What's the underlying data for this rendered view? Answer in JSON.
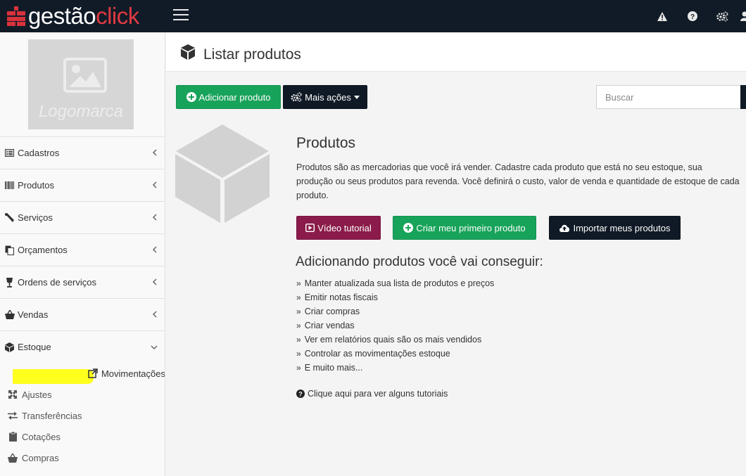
{
  "brand": {
    "part1": "gestão",
    "part2": "click"
  },
  "topbar": {
    "icons": [
      "warning-icon",
      "help-icon",
      "settings-icon",
      "user-icon"
    ]
  },
  "sidebar": {
    "logo_label": "Logomarca",
    "items": [
      {
        "label": "Cadastros",
        "icon": "list-icon"
      },
      {
        "label": "Produtos",
        "icon": "barcode-icon"
      },
      {
        "label": "Serviços",
        "icon": "wrench-icon"
      },
      {
        "label": "Orçamentos",
        "icon": "copy-icon"
      },
      {
        "label": "Ordens de serviços",
        "icon": "glass-icon"
      },
      {
        "label": "Vendas",
        "icon": "basket-icon"
      },
      {
        "label": "Estoque",
        "icon": "cube-icon"
      }
    ],
    "stock_submenu": [
      {
        "label": "Movimentações",
        "icon": "external-link-icon"
      },
      {
        "label": "Ajustes",
        "icon": "arrows-icon"
      },
      {
        "label": "Transferências",
        "icon": "exchange-icon"
      },
      {
        "label": "Cotações",
        "icon": "clipboard-icon"
      },
      {
        "label": "Compras",
        "icon": "basket-icon"
      }
    ]
  },
  "header": {
    "title": "Listar produtos"
  },
  "toolbar": {
    "add_label": "Adicionar produto",
    "more_label": "Mais ações",
    "search_placeholder": "Buscar"
  },
  "empty_state": {
    "title": "Produtos",
    "description": "Produtos são as mercadorias que você irá vender. Cadastre cada produto que está no seu estoque, sua produção ou seus produtos para revenda. Você definirá o custo, valor de venda e quantidade de estoque de cada produto.",
    "video_label": "Vídeo tutorial",
    "create_label": "Criar meu primeiro produto",
    "import_label": "Importar meus produtos",
    "benefits_title": "Adicionando produtos você vai conseguir:",
    "benefits": [
      "Manter atualizada sua lista de produtos e preços",
      "Emitir notas fiscais",
      "Criar compras",
      "Criar vendas",
      "Ver em relatórios quais são os mais vendidos",
      "Controlar as movimentações estoque",
      "E muito mais..."
    ],
    "help_link": "Clique aqui para ver alguns tutoriais"
  },
  "colors": {
    "topbar": "#111b27",
    "brand_red": "#e03a41",
    "green": "#18a35a",
    "dark": "#101a26",
    "purple": "#8a1b4a",
    "highlight": "#ffff1e"
  }
}
